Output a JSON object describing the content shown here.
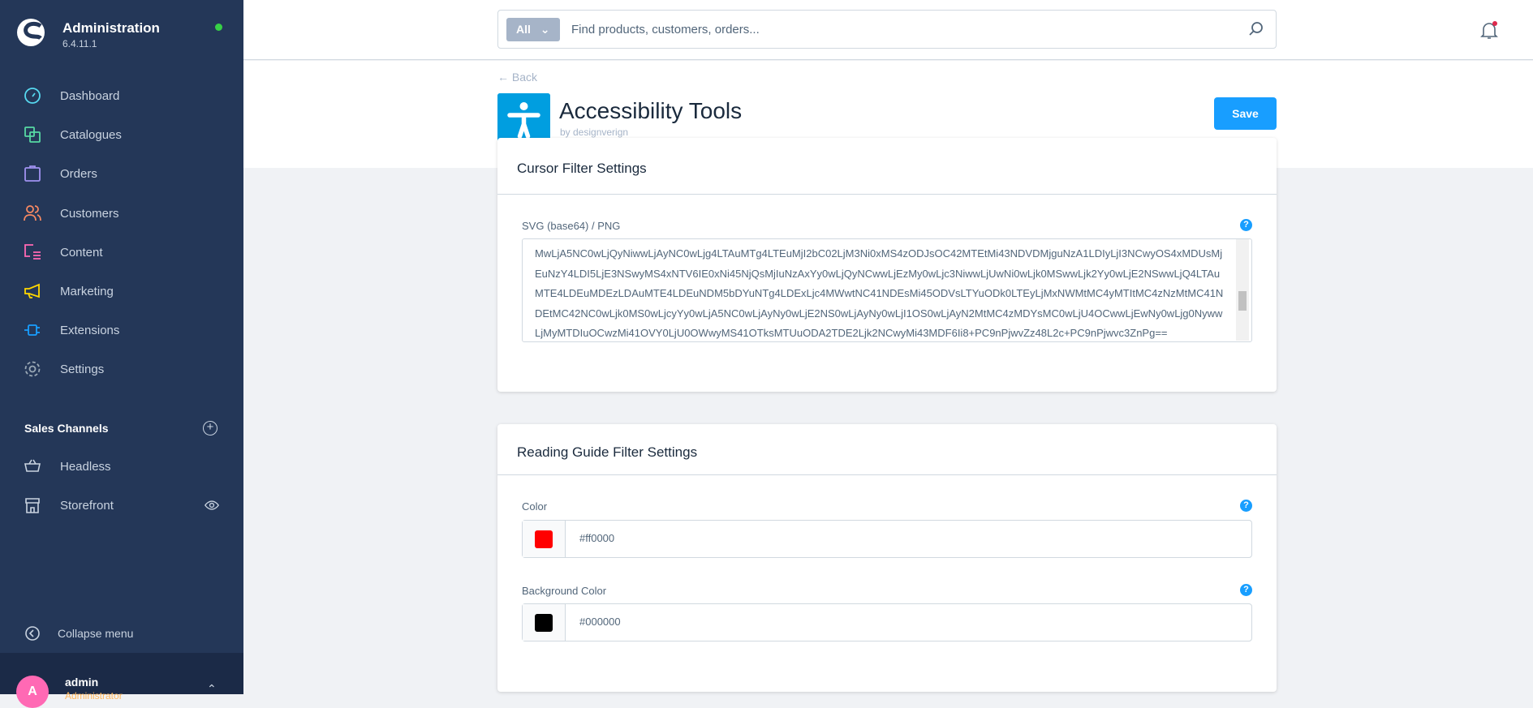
{
  "sidebar": {
    "title": "Administration",
    "version": "6.4.11.1",
    "items": [
      {
        "label": "Dashboard",
        "icon": "dashboard-icon",
        "color": "#57d9f0"
      },
      {
        "label": "Catalogues",
        "icon": "catalogues-icon",
        "color": "#57d9a3"
      },
      {
        "label": "Orders",
        "icon": "orders-icon",
        "color": "#a092f0"
      },
      {
        "label": "Customers",
        "icon": "customers-icon",
        "color": "#f88962"
      },
      {
        "label": "Content",
        "icon": "content-icon",
        "color": "#ff68b4"
      },
      {
        "label": "Marketing",
        "icon": "marketing-icon",
        "color": "#ffd700"
      },
      {
        "label": "Extensions",
        "icon": "extensions-icon",
        "color": "#189eff"
      },
      {
        "label": "Settings",
        "icon": "settings-icon",
        "color": "#9aa8b5"
      }
    ],
    "sales_channels_title": "Sales Channels",
    "sales_channels": [
      {
        "label": "Headless"
      },
      {
        "label": "Storefront"
      }
    ],
    "collapse_label": "Collapse menu",
    "user": {
      "initial": "A",
      "name": "admin",
      "role": "Administrator"
    }
  },
  "header": {
    "search_type": "All",
    "search_placeholder": "Find products, customers, orders..."
  },
  "page": {
    "back": "Back",
    "title": "Accessibility Tools",
    "by": "by designverign",
    "save": "Save"
  },
  "cursor_card": {
    "title": "Cursor Filter Settings",
    "svg_label": "SVG (base64) / PNG",
    "svg_value": "MwLjA5NC0wLjQyNiwwLjAyNC0wLjg4LTAuMTg4LTEuMjI2bC02LjM3Ni0xMS4zODJsOC42MTEtMi43NDVDMjguNzA1LDIyLjI3NCwyOS4xMDUsMjEuNzY4LDI5LjE3NSwyMS4xNTV6IE0xNi45NjQsMjIuNzAxYy0wLjQyNCwwLjEzMy0wLjc3NiwwLjUwNi0wLjk0MSwwLjk2Yy0wLjE2NSwwLjQ4LTAuMTE4LDEuMDEzLDAuMTE4LDEuNDM5bDYuNTg4LDExLjc4MWwtNC41NDEsMi45ODVsLTYuODk0LTEyLjMxNWMtMC4yMTItMC4zNzMtMC41NDEtMC42NC0wLjk0MS0wLjcyYy0wLjA5NC0wLjAyNy0wLjE2NS0wLjAyNy0wLjI1OS0wLjAyN2MtMC4zMDYsMC0wLjU4OCwwLjEwNy0wLjg0NywwLjMyMTDIuOCwzMi41OVY0LjU0OWwyMS41OTksMTUuODA2TDE2Ljk2NCwyMi43MDF6Ii8+PC9nPjwvZz48L2c+PC9nPjwvc3ZnPg=="
  },
  "reading_card": {
    "title": "Reading Guide Filter Settings",
    "color_label": "Color",
    "color_value": "#ff0000",
    "bg_label": "Background Color",
    "bg_value": "#000000"
  },
  "colors": {
    "sidebar": "#243758",
    "accent": "#189eff",
    "app_icon": "#009ee0"
  }
}
